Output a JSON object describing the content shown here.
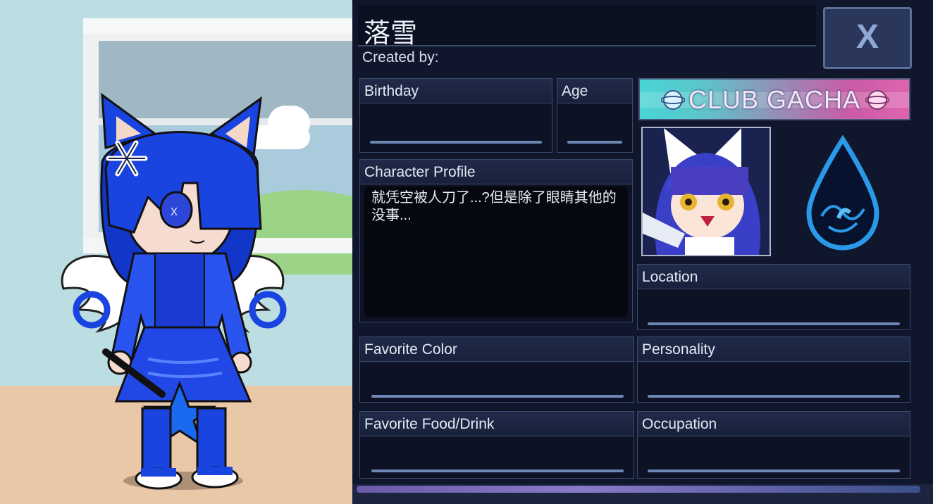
{
  "character": {
    "name": "落雪",
    "created_by_label": "Created by:"
  },
  "close_button": {
    "label": "X"
  },
  "fields": {
    "birthday": {
      "label": "Birthday",
      "value": ""
    },
    "age": {
      "label": "Age",
      "value": ""
    },
    "character_profile": {
      "label": "Character Profile",
      "value": "就凭空被人刀了...?但是除了眼睛其他的没事..."
    },
    "location": {
      "label": "Location",
      "value": ""
    },
    "favorite_color": {
      "label": "Favorite Color",
      "value": ""
    },
    "personality": {
      "label": "Personality",
      "value": ""
    },
    "favorite_food": {
      "label": "Favorite Food/Drink",
      "value": ""
    },
    "occupation": {
      "label": "Occupation",
      "value": ""
    }
  },
  "banner": {
    "text": "CLUB GACHA"
  },
  "icons": {
    "close": "close-x-icon",
    "element": "water-drop-icon",
    "hair_clip": "snowflake-icon"
  },
  "colors": {
    "panel_bg": "#10162b",
    "accent": "#6e86b6",
    "hair": "#1a44e0",
    "banner_left": "#48d4d6",
    "banner_right": "#e064b0"
  }
}
